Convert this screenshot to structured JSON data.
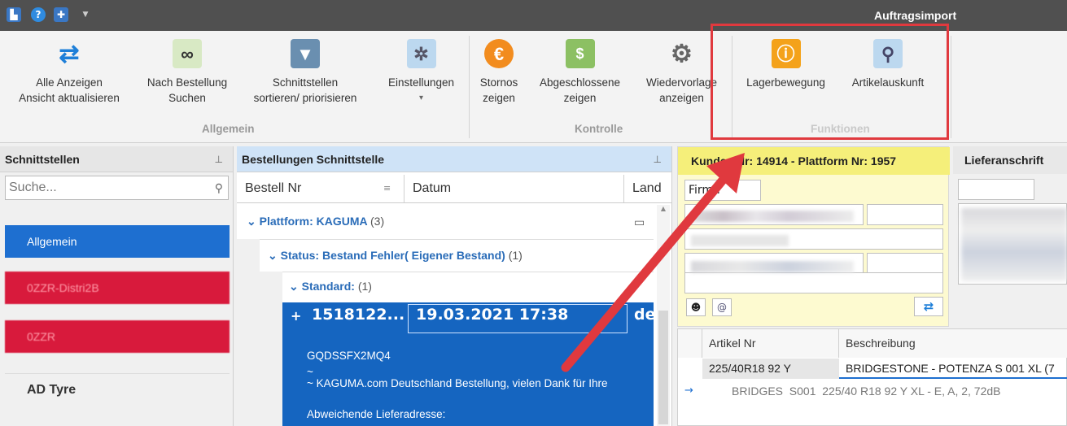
{
  "window": {
    "title": "Auftragsimport",
    "quick_access": [
      "app-icon",
      "help-icon",
      "medical-icon",
      "dropdown-icon"
    ]
  },
  "ribbon": {
    "buttons": [
      {
        "label1": "Alle Anzeigen",
        "label2": "Ansicht aktualisieren",
        "icon": "refresh-icon"
      },
      {
        "label1": "Nach Bestellung",
        "label2": "Suchen",
        "icon": "binoculars-icon"
      },
      {
        "label1": "Schnittstellen",
        "label2": "sortieren/ priorisieren",
        "icon": "filter-sort-icon"
      },
      {
        "label1": "Einstellungen",
        "label2": "▾",
        "icon": "settings-window-icon"
      },
      {
        "label1": "Stornos",
        "label2": "zeigen",
        "icon": "euro-cancel-icon"
      },
      {
        "label1": "Abgeschlossene",
        "label2": "zeigen",
        "icon": "money-icon"
      },
      {
        "label1": "Wiedervorlage",
        "label2": "anzeigen",
        "icon": "gear-refresh-icon"
      },
      {
        "label1": "Lagerbewegung",
        "label2": "",
        "icon": "warehouse-info-icon"
      },
      {
        "label1": "Artikelauskunft",
        "label2": "",
        "icon": "article-search-icon"
      }
    ],
    "groups": {
      "allgemein": "Allgemein",
      "kontrolle": "Kontrolle",
      "funktionen": "Funktionen"
    }
  },
  "left_panel": {
    "title": "Schnittstellen",
    "search_placeholder": "Suche...",
    "items": [
      {
        "label": "Allgemein",
        "color": "#1e6fd0"
      },
      {
        "label": "0ZZR-Distri2B",
        "color": "#d81a3c"
      },
      {
        "label": "0ZZR",
        "color": "#d81a3c"
      },
      {
        "label": "AD Tyre",
        "color": "#f0f0f0"
      }
    ]
  },
  "middle_panel": {
    "title": "Bestellungen Schnittstelle",
    "columns": [
      "Bestell Nr",
      "Datum",
      "Land"
    ],
    "group_platform": {
      "label": "Plattform: KAGUMA",
      "count": "(3)"
    },
    "group_status": {
      "label": "Status: Bestand Fehler( Eigener Bestand)",
      "count": "(1)"
    },
    "group_standard": {
      "label": "Standard:",
      "count": "(1)"
    },
    "selected_row": {
      "expander": "+",
      "order_nr": "1518122...",
      "date": "19.03.2021 17:38",
      "land": "de",
      "line1": "GQDSSFX2MQ4",
      "line2": "~",
      "line3": "~ KAGUMA.com Deutschland Bestellung, vielen Dank für Ihre",
      "line4": "Abweichende Lieferadresse:"
    }
  },
  "right_panel": {
    "customer_header": "Kunden Nr: 14914 - Plattform Nr: 1957",
    "firma_placeholder": "Firma",
    "delivery_header": "Lieferanschrift",
    "article_grid": {
      "columns": [
        "Artikel Nr",
        "Beschreibung"
      ],
      "row": {
        "artikel_nr": "225/40R18 92 Y",
        "beschreibung": "BRIDGESTONE - POTENZA S 001 XL (7"
      },
      "detail": "BRIDGES  S001  225/40 R18 92 Y XL - E, A, 2, 72dB"
    }
  },
  "colors": {
    "highlight": "#e0393e",
    "selection": "#1565c0",
    "pane_header": "#cfe3f7",
    "customer_bg": "#fdfad0"
  }
}
